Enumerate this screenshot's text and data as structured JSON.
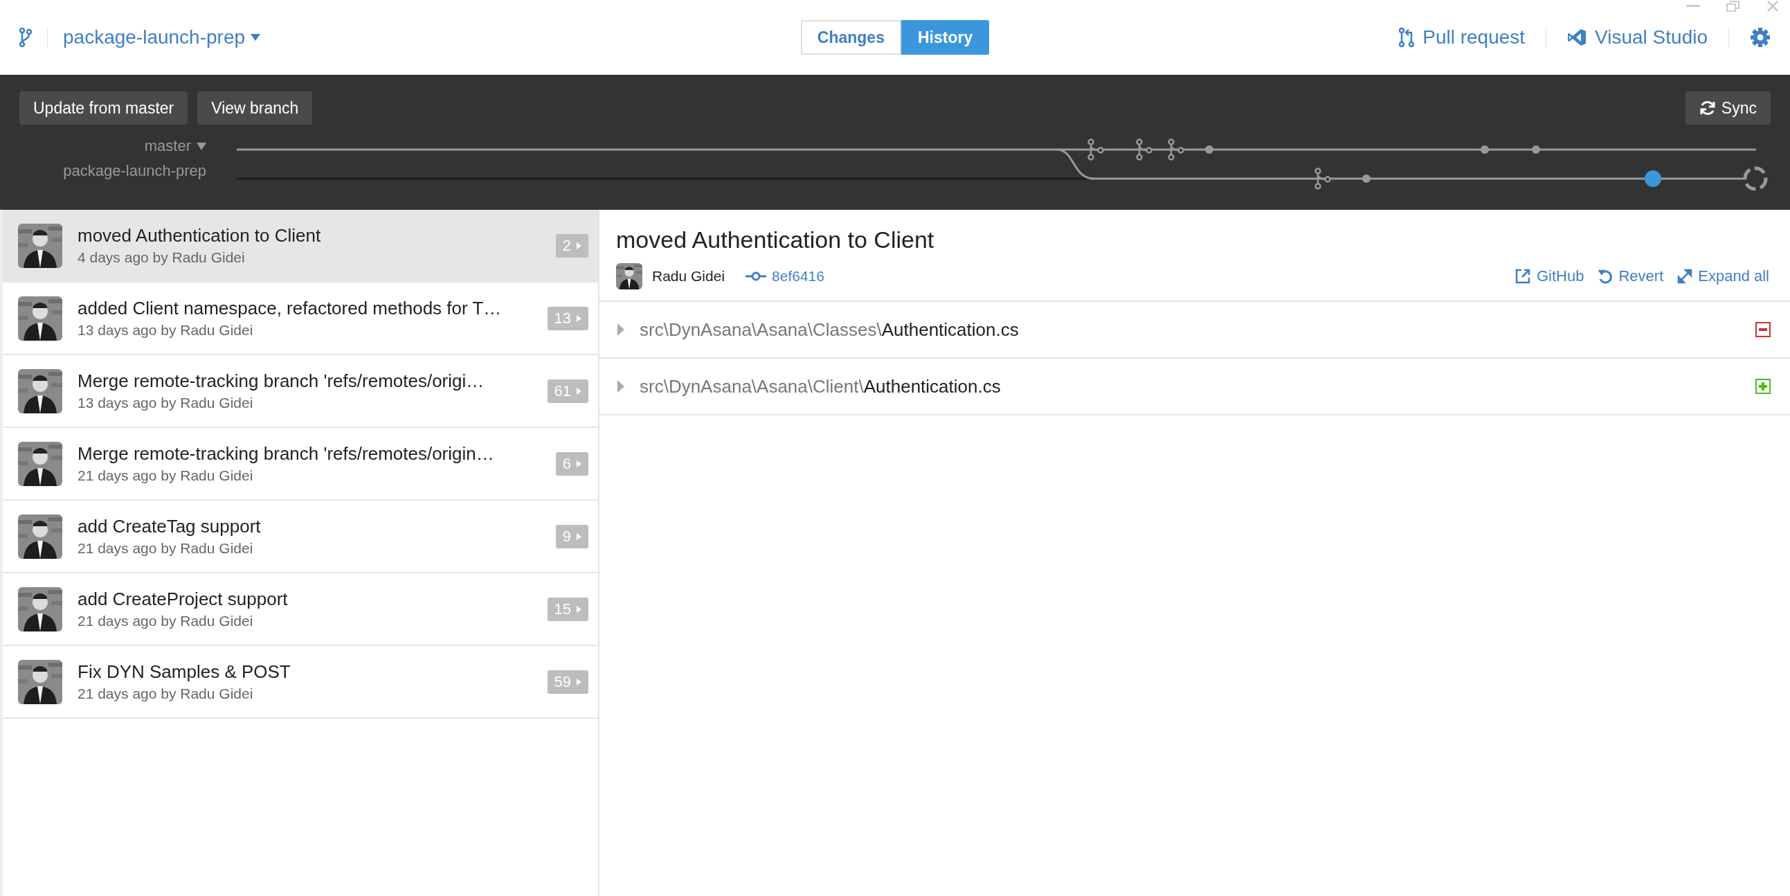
{
  "branch_selector": {
    "name": "package-launch-prep"
  },
  "tabs": [
    {
      "label": "Changes",
      "selected": false
    },
    {
      "label": "History",
      "selected": true
    }
  ],
  "toolbar_links": [
    {
      "kind": "pull-request",
      "label": "Pull request"
    },
    {
      "kind": "visual-studio",
      "label": "Visual Studio"
    }
  ],
  "branch_actions": [
    "Update from master",
    "View branch"
  ],
  "sync_button": {
    "label": "Sync"
  },
  "branches": [
    {
      "name": "master",
      "dropdown": true
    },
    {
      "name": "package-launch-prep",
      "dropdown": false
    }
  ],
  "commits": [
    {
      "title": "moved Authentication to Client",
      "meta": "4 days ago by Radu Gidei",
      "count": "2",
      "selected": true
    },
    {
      "title": "added Client namespace, refactored methods for T…",
      "meta": "13 days ago by Radu Gidei",
      "count": "13",
      "selected": false
    },
    {
      "title": "Merge remote-tracking branch 'refs/remotes/origi…",
      "meta": "13 days ago by Radu Gidei",
      "count": "61",
      "selected": false
    },
    {
      "title": "Merge remote-tracking branch 'refs/remotes/origin…",
      "meta": "21 days ago by Radu Gidei",
      "count": "6",
      "selected": false
    },
    {
      "title": "add CreateTag support",
      "meta": "21 days ago by Radu Gidei",
      "count": "9",
      "selected": false
    },
    {
      "title": "add CreateProject support",
      "meta": "21 days ago by Radu Gidei",
      "count": "15",
      "selected": false
    },
    {
      "title": "Fix DYN Samples & POST",
      "meta": "21 days ago by Radu Gidei",
      "count": "59",
      "selected": false
    }
  ],
  "detail": {
    "title": "moved Authentication to Client",
    "author": "Radu Gidei",
    "hash": "8ef6416",
    "actions": [
      {
        "kind": "github",
        "label": "GitHub"
      },
      {
        "kind": "revert",
        "label": "Revert"
      },
      {
        "kind": "expand",
        "label": "Expand all"
      }
    ],
    "files": [
      {
        "directory": "src\\DynAsana\\Asana\\Classes\\",
        "filename": "Authentication.cs",
        "kind": "deleted"
      },
      {
        "directory": "src\\DynAsana\\Asana\\Client\\",
        "filename": "Authentication.cs",
        "kind": "added"
      }
    ]
  }
}
